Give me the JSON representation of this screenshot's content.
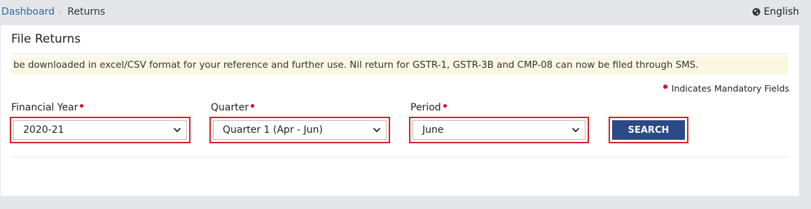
{
  "breadcrumb": {
    "home": "Dashboard",
    "separator": "›",
    "current": "Returns"
  },
  "language": {
    "label": "English",
    "icon": "globe-icon"
  },
  "card": {
    "title": "File Returns",
    "notice": "be downloaded in excel/CSV format for your reference and further use. Nil return for GSTR-1, GSTR-3B and CMP-08 can now be filed through SMS.",
    "mandatory_note": "Indicates Mandatory Fields"
  },
  "filters": {
    "financial_year": {
      "label": "Financial Year",
      "value": "2020-21"
    },
    "quarter": {
      "label": "Quarter",
      "value": "Quarter 1 (Apr - Jun)"
    },
    "period": {
      "label": "Period",
      "value": "June"
    }
  },
  "search_button": {
    "label": "SEARCH"
  },
  "colors": {
    "page_bg": "#e4e6e9",
    "link": "#2c6aa8",
    "notice_bg": "#fbf8e2",
    "mandatory_dot": "#e0001a",
    "highlight_outline": "#d9202a",
    "button_bg": "#2b4a86"
  }
}
